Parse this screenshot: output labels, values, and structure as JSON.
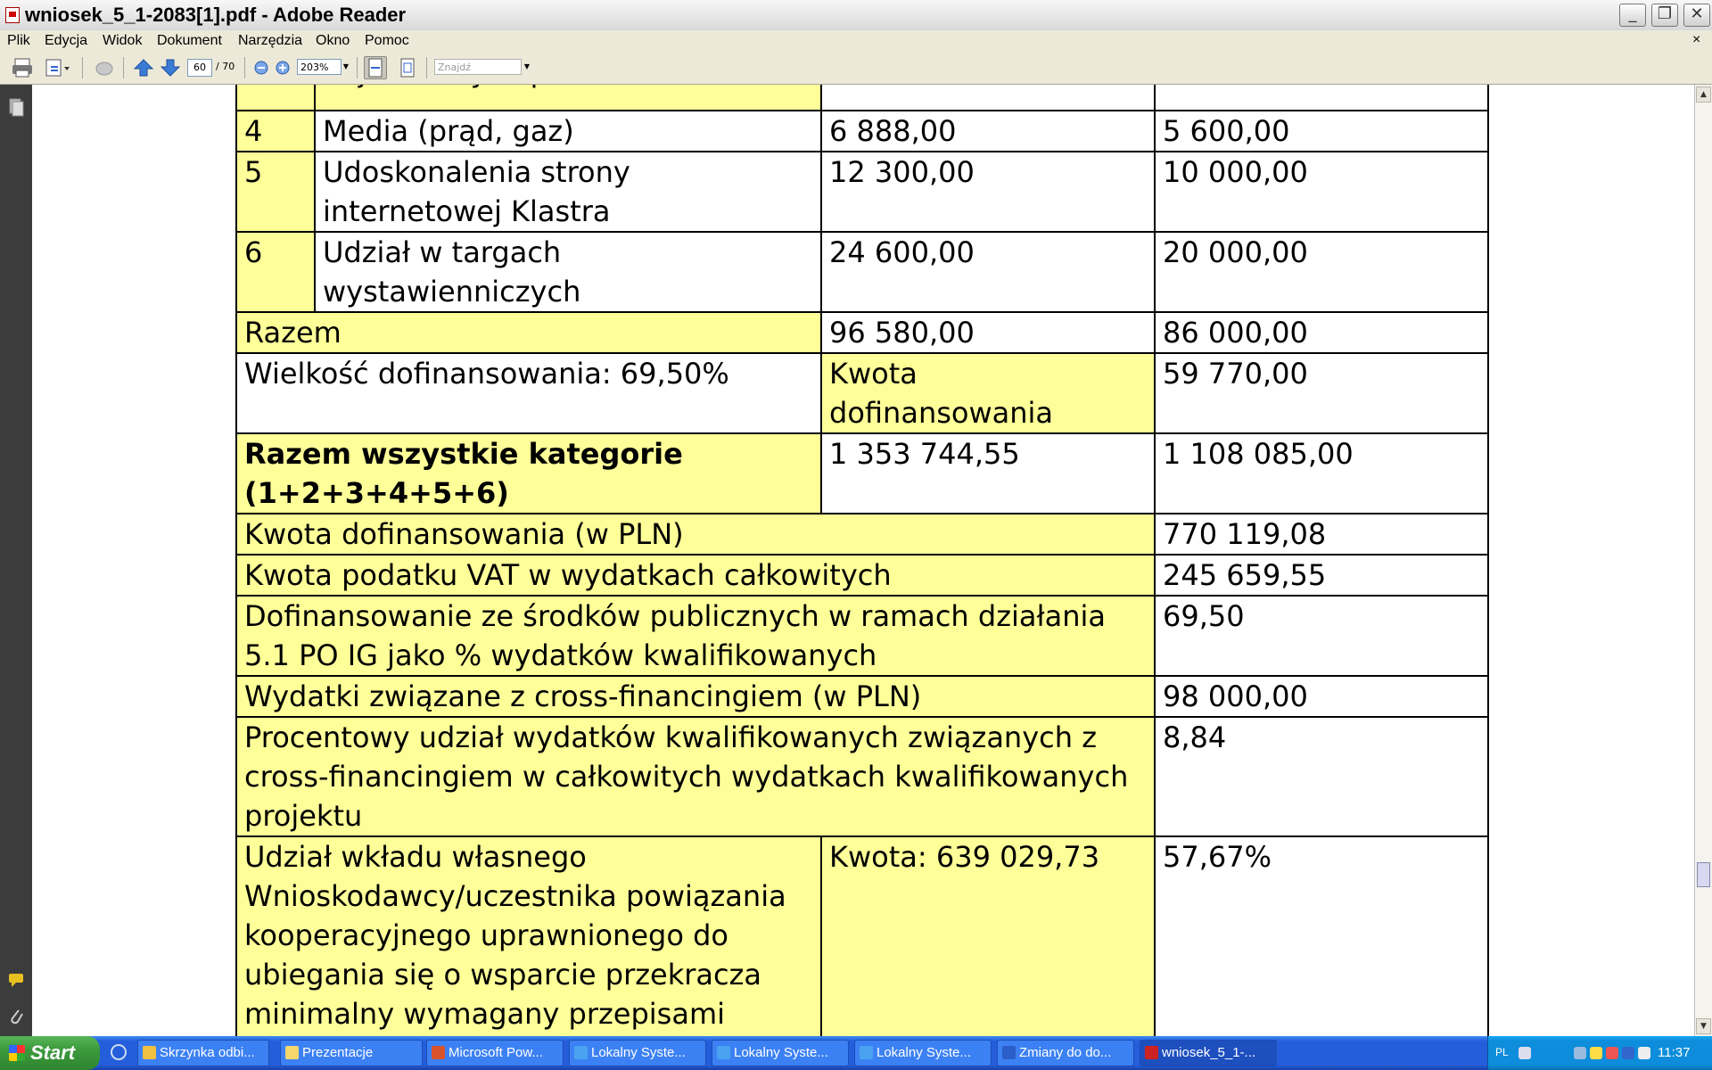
{
  "window": {
    "title": "wniosek_5_1-2083[1].pdf - Adobe Reader"
  },
  "menu": {
    "items": [
      "Plik",
      "Edycja",
      "Widok",
      "Dokument",
      "Narzędzia",
      "Okno",
      "Pomoc"
    ],
    "close_glyph": "×"
  },
  "toolbar": {
    "current_page": "60",
    "total_pages": "/ 70",
    "zoom": "203%",
    "find_placeholder": "Znajdź",
    "icons": [
      "print-icon",
      "email-icon",
      "hand-icon",
      "page-up-icon",
      "page-down-icon",
      "zoom-out-icon",
      "zoom-in-icon",
      "fit-width-icon",
      "fit-page-icon"
    ]
  },
  "document": {
    "partial_row_text": "najmowanych pomieszczeń",
    "rows": [
      {
        "no": "4",
        "name": "Media (prąd, gaz)",
        "col3": "6 888,00",
        "col4": "5 600,00"
      },
      {
        "no": "5",
        "name": "Udoskonalenia strony internetowej Klastra",
        "col3": "12 300,00",
        "col4": "10 000,00"
      },
      {
        "no": "6",
        "name": "Udział w targach wystawienniczych",
        "col3": "24 600,00",
        "col4": "20 000,00"
      }
    ],
    "razem": {
      "label": "Razem",
      "col3": "96 580,00",
      "col4": "86 000,00"
    },
    "dofinans": {
      "label": "Wielkość dofinansowania: 69,50%",
      "kwota_label": "Kwota dofinansowania",
      "value": "59 770,00"
    },
    "razem_all": {
      "label": "Razem wszystkie kategorie (1+2+3+4+5+6)",
      "col3": "1 353 744,55",
      "col4": "1 108 085,00"
    },
    "summary": [
      {
        "label": "Kwota dofinansowania (w PLN)",
        "value": "770 119,08"
      },
      {
        "label": "Kwota podatku VAT w wydatkach całkowitych",
        "value": "245 659,55"
      },
      {
        "label": "Dofinansowanie ze środków publicznych w ramach działania 5.1 PO IG jako % wydatków kwalifikowanych",
        "value": "69,50"
      },
      {
        "label": "Wydatki związane z cross-financingiem (w PLN)",
        "value": "98 000,00"
      },
      {
        "label": "Procentowy udział wydatków kwalifikowanych związanych z cross-financingiem w całkowitych wydatkach kwalifikowanych projektu",
        "value": "8,84"
      }
    ],
    "own_share": {
      "label": "Udział wkładu własnego Wnioskodawcy/uczestnika powiązania kooperacyjnego uprawnionego do ubiegania się o wsparcie przekracza minimalny wymagany przepisami Rozporządzenia (jeśli dotyczy)",
      "kwota": "Kwota: 639 029,73",
      "percent": "57,67%"
    }
  },
  "taskbar": {
    "start_label": "Start",
    "tasks": [
      {
        "label": "Skrzynka odbi...",
        "color": "#f0c040"
      },
      {
        "label": "Prezentacje",
        "color": "#f5d76e"
      },
      {
        "label": "Microsoft Pow...",
        "color": "#d9532c"
      },
      {
        "label": "Lokalny Syste...",
        "color": "#4aa3f0"
      },
      {
        "label": "Lokalny Syste...",
        "color": "#4aa3f0"
      },
      {
        "label": "Lokalny Syste...",
        "color": "#4aa3f0"
      },
      {
        "label": "Zmiany do do...",
        "color": "#2b5ec8"
      },
      {
        "label": "wniosek_5_1-...",
        "color": "#cc2222"
      }
    ],
    "tray": {
      "lang": "PL",
      "clock": "11:37"
    }
  }
}
